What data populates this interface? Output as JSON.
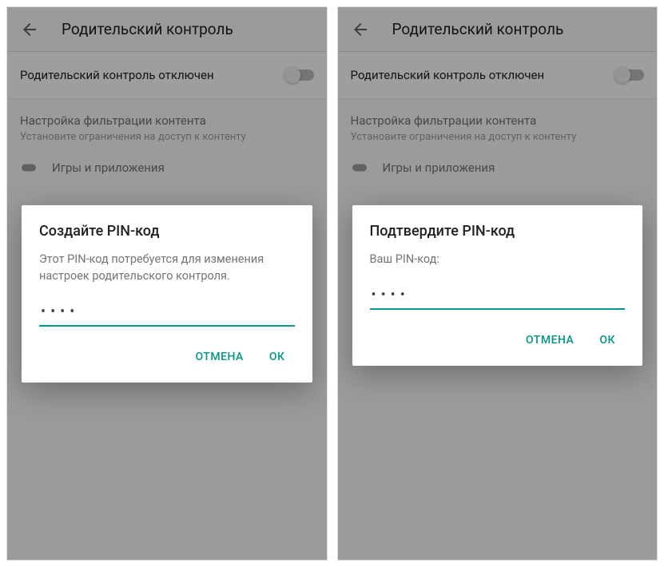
{
  "accent_color": "#009688",
  "screens": [
    {
      "appbar": {
        "title": "Родительский контроль"
      },
      "toggle_row": {
        "label": "Родительский контроль отключен",
        "on": false
      },
      "filter_section": {
        "title": "Настройка фильтрации контента",
        "subtitle": "Установите ограничения на доступ к контенту"
      },
      "list": {
        "item1": "Игры и приложения"
      },
      "dialog": {
        "title": "Создайте PIN-код",
        "body": "Этот PIN-код потребуется для изменения настроек родительского контроля.",
        "pin_value": "••••",
        "cancel": "ОТМЕНА",
        "ok": "ОК"
      }
    },
    {
      "appbar": {
        "title": "Родительский контроль"
      },
      "toggle_row": {
        "label": "Родительский контроль отключен",
        "on": false
      },
      "filter_section": {
        "title": "Настройка фильтрации контента",
        "subtitle": "Установите ограничения на доступ к контенту"
      },
      "list": {
        "item1": "Игры и приложения"
      },
      "dialog": {
        "title": "Подтвердите PIN-код",
        "body": "Ваш PIN-код:",
        "pin_value": "••••",
        "cancel": "ОТМЕНА",
        "ok": "ОК"
      }
    }
  ]
}
